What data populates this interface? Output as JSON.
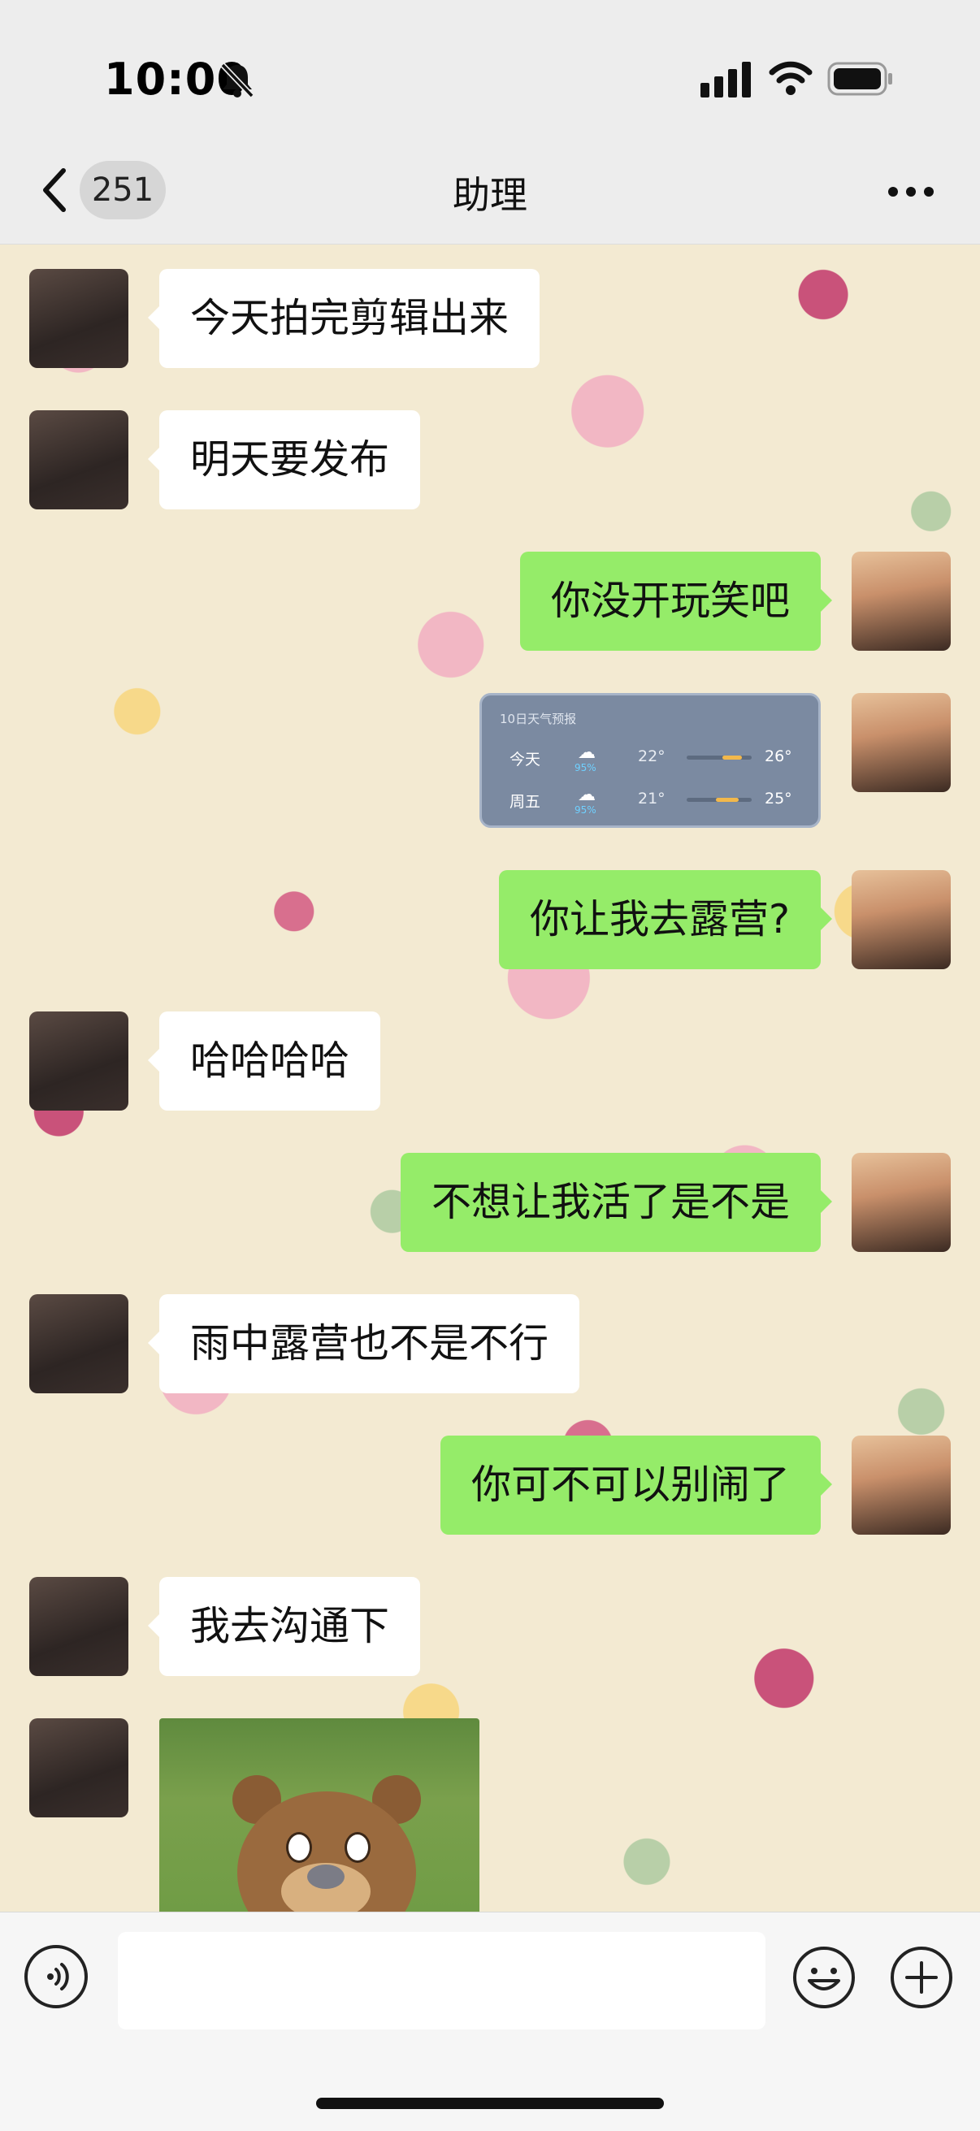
{
  "status": {
    "time": "10:00"
  },
  "nav": {
    "badge": "251",
    "title": "助理"
  },
  "messages": [
    {
      "side": "left",
      "text": "今天拍完剪辑出来"
    },
    {
      "side": "left",
      "text": "明天要发布"
    },
    {
      "side": "right",
      "text": "你没开玩笑吧"
    },
    {
      "side": "right",
      "type": "weather"
    },
    {
      "side": "right",
      "text": "你让我去露营?"
    },
    {
      "side": "left",
      "text": "哈哈哈哈"
    },
    {
      "side": "right",
      "text": "不想让我活了是不是"
    },
    {
      "side": "left",
      "text": "雨中露营也不是不行"
    },
    {
      "side": "right",
      "text": "你可不可以别闹了"
    },
    {
      "side": "left",
      "text": "我去沟通下"
    },
    {
      "side": "left",
      "type": "sticker"
    }
  ],
  "weather": {
    "title": "10日天气预报",
    "rows": [
      {
        "day": "今天",
        "precip": "95%",
        "low": "22°",
        "high": "26°",
        "bar_start": 0.55,
        "bar_end": 0.85
      },
      {
        "day": "周五",
        "precip": "95%",
        "low": "21°",
        "high": "25°",
        "bar_start": 0.45,
        "bar_end": 0.8
      }
    ]
  },
  "colors": {
    "self_bubble": "#95ec69",
    "other_bubble": "#ffffff",
    "chrome": "#ededed"
  },
  "icons": [
    "back-chevron-icon",
    "more-dots-icon",
    "voice-icon",
    "emoji-icon",
    "add-icon",
    "bell-muted-icon",
    "signal-icon",
    "wifi-icon",
    "battery-icon"
  ]
}
